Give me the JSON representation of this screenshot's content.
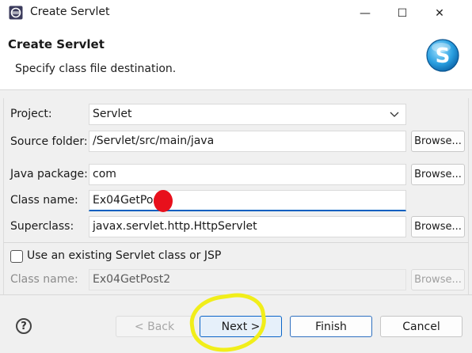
{
  "window": {
    "title": "Create Servlet",
    "minimize_glyph": "—",
    "maximize_glyph": "☐",
    "close_glyph": "✕"
  },
  "header": {
    "title": "Create Servlet",
    "description": "Specify class file destination.",
    "logo_letter": "S"
  },
  "form": {
    "project": {
      "label": "Project:",
      "value": "Servlet"
    },
    "source_folder": {
      "label": "Source folder:",
      "value": "/Servlet/src/main/java",
      "browse": "Browse..."
    },
    "java_package": {
      "label": "Java package:",
      "value": "com",
      "browse": "Browse..."
    },
    "class_name": {
      "label": "Class name:",
      "value": "Ex04GetPost"
    },
    "superclass": {
      "label": "Superclass:",
      "value": "javax.servlet.http.HttpServlet",
      "browse": "Browse..."
    },
    "existing": {
      "label": "Use an existing Servlet class or JSP",
      "checked": false
    },
    "existing_class": {
      "label": "Class name:",
      "value": "Ex04GetPost2",
      "browse": "Browse..."
    }
  },
  "buttons": {
    "help": "?",
    "back": "< Back",
    "next": "Next >",
    "finish": "Finish",
    "cancel": "Cancel"
  },
  "colors": {
    "annotation_dot": "#e8101c",
    "annotation_highlight": "#f1ee1a",
    "focus_blue": "#0060c0"
  }
}
